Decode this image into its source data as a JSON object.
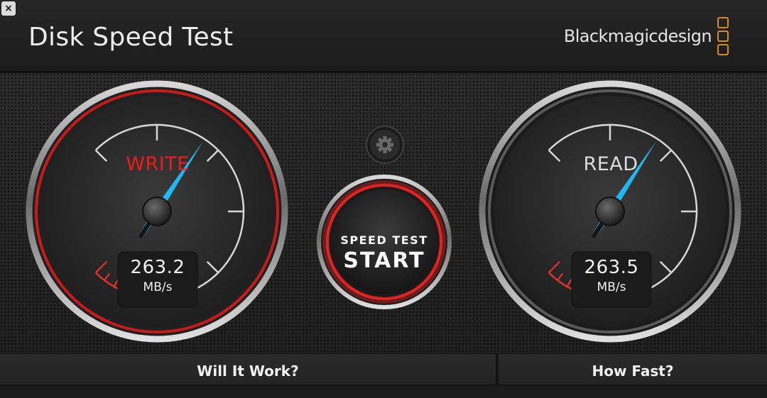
{
  "window": {
    "close_glyph": "×"
  },
  "header": {
    "title": "Disk Speed Test",
    "brand": "Blackmagicdesign",
    "brand_color": "#d98a1c"
  },
  "write_gauge": {
    "label": "WRITE",
    "value": "263.2",
    "unit": "MB/s",
    "accent": "#ef1b1b",
    "needle_color": "#1fb8f0",
    "level": 0.29
  },
  "read_gauge": {
    "label": "READ",
    "value": "263.5",
    "unit": "MB/s",
    "accent": "#dcdcdc",
    "needle_color": "#1fb8f0",
    "level": 0.29
  },
  "start_button": {
    "line1": "SPEED TEST",
    "line2": "START"
  },
  "settings_button": {
    "icon": "gear-icon"
  },
  "footer": {
    "will_it_work": "Will It Work?",
    "how_fast": "How Fast?"
  }
}
